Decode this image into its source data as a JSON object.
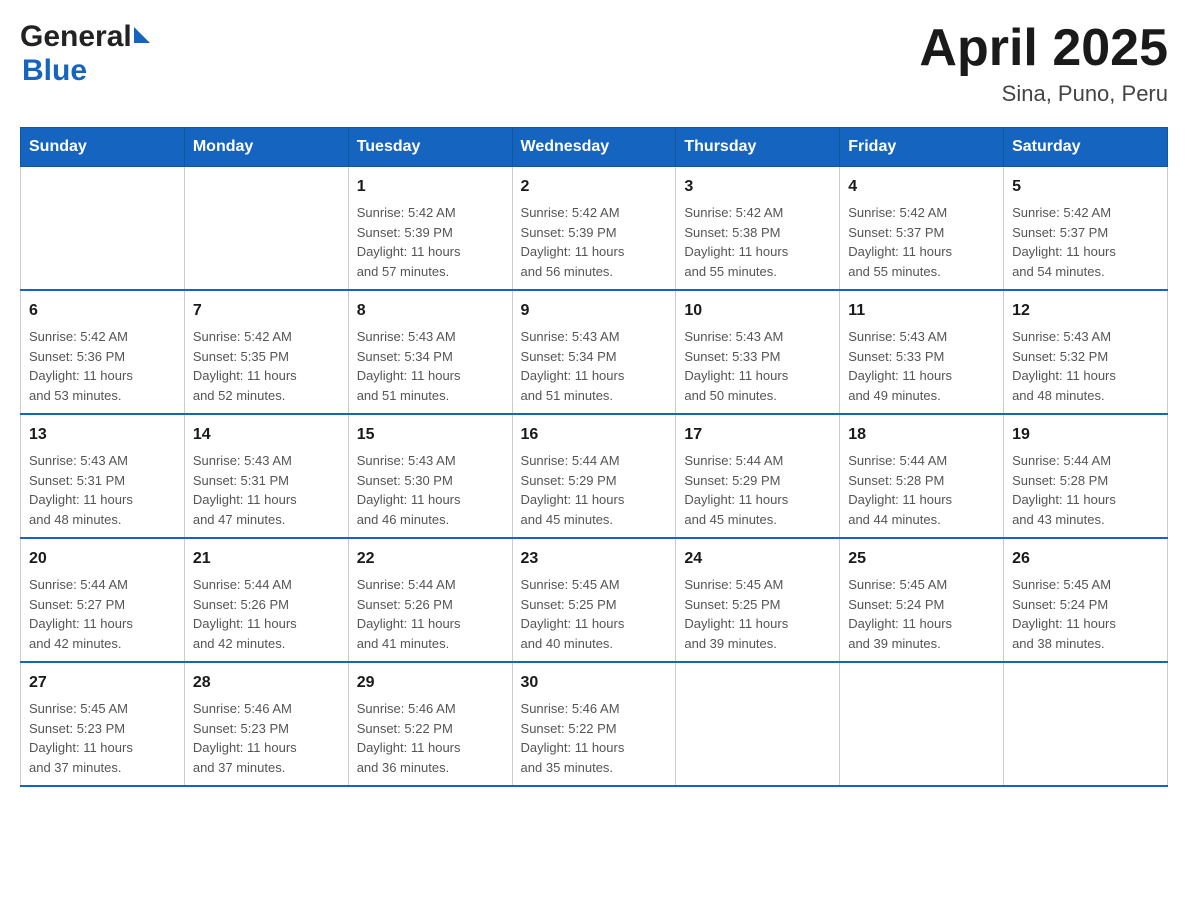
{
  "header": {
    "logo_general": "General",
    "logo_blue": "Blue",
    "title": "April 2025",
    "subtitle": "Sina, Puno, Peru"
  },
  "calendar": {
    "days_of_week": [
      "Sunday",
      "Monday",
      "Tuesday",
      "Wednesday",
      "Thursday",
      "Friday",
      "Saturday"
    ],
    "weeks": [
      [
        {
          "day": "",
          "info": ""
        },
        {
          "day": "",
          "info": ""
        },
        {
          "day": "1",
          "info": "Sunrise: 5:42 AM\nSunset: 5:39 PM\nDaylight: 11 hours\nand 57 minutes."
        },
        {
          "day": "2",
          "info": "Sunrise: 5:42 AM\nSunset: 5:39 PM\nDaylight: 11 hours\nand 56 minutes."
        },
        {
          "day": "3",
          "info": "Sunrise: 5:42 AM\nSunset: 5:38 PM\nDaylight: 11 hours\nand 55 minutes."
        },
        {
          "day": "4",
          "info": "Sunrise: 5:42 AM\nSunset: 5:37 PM\nDaylight: 11 hours\nand 55 minutes."
        },
        {
          "day": "5",
          "info": "Sunrise: 5:42 AM\nSunset: 5:37 PM\nDaylight: 11 hours\nand 54 minutes."
        }
      ],
      [
        {
          "day": "6",
          "info": "Sunrise: 5:42 AM\nSunset: 5:36 PM\nDaylight: 11 hours\nand 53 minutes."
        },
        {
          "day": "7",
          "info": "Sunrise: 5:42 AM\nSunset: 5:35 PM\nDaylight: 11 hours\nand 52 minutes."
        },
        {
          "day": "8",
          "info": "Sunrise: 5:43 AM\nSunset: 5:34 PM\nDaylight: 11 hours\nand 51 minutes."
        },
        {
          "day": "9",
          "info": "Sunrise: 5:43 AM\nSunset: 5:34 PM\nDaylight: 11 hours\nand 51 minutes."
        },
        {
          "day": "10",
          "info": "Sunrise: 5:43 AM\nSunset: 5:33 PM\nDaylight: 11 hours\nand 50 minutes."
        },
        {
          "day": "11",
          "info": "Sunrise: 5:43 AM\nSunset: 5:33 PM\nDaylight: 11 hours\nand 49 minutes."
        },
        {
          "day": "12",
          "info": "Sunrise: 5:43 AM\nSunset: 5:32 PM\nDaylight: 11 hours\nand 48 minutes."
        }
      ],
      [
        {
          "day": "13",
          "info": "Sunrise: 5:43 AM\nSunset: 5:31 PM\nDaylight: 11 hours\nand 48 minutes."
        },
        {
          "day": "14",
          "info": "Sunrise: 5:43 AM\nSunset: 5:31 PM\nDaylight: 11 hours\nand 47 minutes."
        },
        {
          "day": "15",
          "info": "Sunrise: 5:43 AM\nSunset: 5:30 PM\nDaylight: 11 hours\nand 46 minutes."
        },
        {
          "day": "16",
          "info": "Sunrise: 5:44 AM\nSunset: 5:29 PM\nDaylight: 11 hours\nand 45 minutes."
        },
        {
          "day": "17",
          "info": "Sunrise: 5:44 AM\nSunset: 5:29 PM\nDaylight: 11 hours\nand 45 minutes."
        },
        {
          "day": "18",
          "info": "Sunrise: 5:44 AM\nSunset: 5:28 PM\nDaylight: 11 hours\nand 44 minutes."
        },
        {
          "day": "19",
          "info": "Sunrise: 5:44 AM\nSunset: 5:28 PM\nDaylight: 11 hours\nand 43 minutes."
        }
      ],
      [
        {
          "day": "20",
          "info": "Sunrise: 5:44 AM\nSunset: 5:27 PM\nDaylight: 11 hours\nand 42 minutes."
        },
        {
          "day": "21",
          "info": "Sunrise: 5:44 AM\nSunset: 5:26 PM\nDaylight: 11 hours\nand 42 minutes."
        },
        {
          "day": "22",
          "info": "Sunrise: 5:44 AM\nSunset: 5:26 PM\nDaylight: 11 hours\nand 41 minutes."
        },
        {
          "day": "23",
          "info": "Sunrise: 5:45 AM\nSunset: 5:25 PM\nDaylight: 11 hours\nand 40 minutes."
        },
        {
          "day": "24",
          "info": "Sunrise: 5:45 AM\nSunset: 5:25 PM\nDaylight: 11 hours\nand 39 minutes."
        },
        {
          "day": "25",
          "info": "Sunrise: 5:45 AM\nSunset: 5:24 PM\nDaylight: 11 hours\nand 39 minutes."
        },
        {
          "day": "26",
          "info": "Sunrise: 5:45 AM\nSunset: 5:24 PM\nDaylight: 11 hours\nand 38 minutes."
        }
      ],
      [
        {
          "day": "27",
          "info": "Sunrise: 5:45 AM\nSunset: 5:23 PM\nDaylight: 11 hours\nand 37 minutes."
        },
        {
          "day": "28",
          "info": "Sunrise: 5:46 AM\nSunset: 5:23 PM\nDaylight: 11 hours\nand 37 minutes."
        },
        {
          "day": "29",
          "info": "Sunrise: 5:46 AM\nSunset: 5:22 PM\nDaylight: 11 hours\nand 36 minutes."
        },
        {
          "day": "30",
          "info": "Sunrise: 5:46 AM\nSunset: 5:22 PM\nDaylight: 11 hours\nand 35 minutes."
        },
        {
          "day": "",
          "info": ""
        },
        {
          "day": "",
          "info": ""
        },
        {
          "day": "",
          "info": ""
        }
      ]
    ]
  }
}
